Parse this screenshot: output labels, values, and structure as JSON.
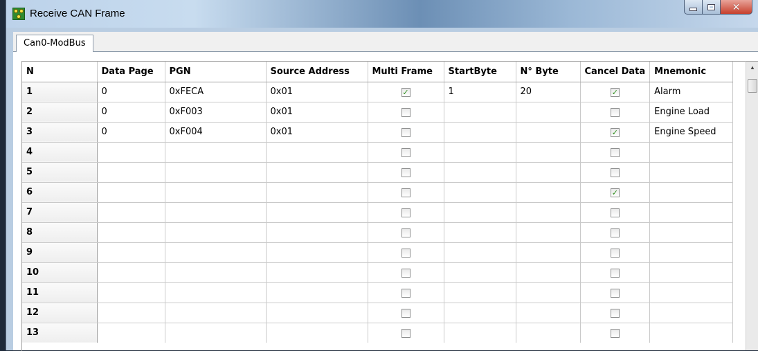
{
  "window": {
    "title": "Receive CAN Frame",
    "icon": "can-network-icon",
    "buttons": {
      "minimize": "minimize",
      "maximize": "maximize",
      "close": "close"
    }
  },
  "tabs": [
    {
      "label": "Can0-ModBus",
      "active": true
    }
  ],
  "table": {
    "columns": [
      "N",
      "Data Page",
      "PGN",
      "Source Address",
      "Multi Frame",
      "StartByte",
      "N° Byte",
      "Cancel Data",
      "Mnemonic"
    ],
    "rows": [
      {
        "n": "1",
        "data_page": "0",
        "pgn": "0xFECA",
        "source_address": "0x01",
        "multi_frame": true,
        "start_byte": "1",
        "n_byte": "20",
        "cancel_data": true,
        "mnemonic": "Alarm"
      },
      {
        "n": "2",
        "data_page": "0",
        "pgn": "0xF003",
        "source_address": "0x01",
        "multi_frame": false,
        "start_byte": "",
        "n_byte": "",
        "cancel_data": false,
        "mnemonic": "Engine Load"
      },
      {
        "n": "3",
        "data_page": "0",
        "pgn": "0xF004",
        "source_address": "0x01",
        "multi_frame": false,
        "start_byte": "",
        "n_byte": "",
        "cancel_data": true,
        "mnemonic": "Engine Speed"
      },
      {
        "n": "4",
        "data_page": "",
        "pgn": "",
        "source_address": "",
        "multi_frame": false,
        "start_byte": "",
        "n_byte": "",
        "cancel_data": false,
        "mnemonic": ""
      },
      {
        "n": "5",
        "data_page": "",
        "pgn": "",
        "source_address": "",
        "multi_frame": false,
        "start_byte": "",
        "n_byte": "",
        "cancel_data": false,
        "mnemonic": ""
      },
      {
        "n": "6",
        "data_page": "",
        "pgn": "",
        "source_address": "",
        "multi_frame": false,
        "start_byte": "",
        "n_byte": "",
        "cancel_data": true,
        "mnemonic": ""
      },
      {
        "n": "7",
        "data_page": "",
        "pgn": "",
        "source_address": "",
        "multi_frame": false,
        "start_byte": "",
        "n_byte": "",
        "cancel_data": false,
        "mnemonic": ""
      },
      {
        "n": "8",
        "data_page": "",
        "pgn": "",
        "source_address": "",
        "multi_frame": false,
        "start_byte": "",
        "n_byte": "",
        "cancel_data": false,
        "mnemonic": ""
      },
      {
        "n": "9",
        "data_page": "",
        "pgn": "",
        "source_address": "",
        "multi_frame": false,
        "start_byte": "",
        "n_byte": "",
        "cancel_data": false,
        "mnemonic": ""
      },
      {
        "n": "10",
        "data_page": "",
        "pgn": "",
        "source_address": "",
        "multi_frame": false,
        "start_byte": "",
        "n_byte": "",
        "cancel_data": false,
        "mnemonic": ""
      },
      {
        "n": "11",
        "data_page": "",
        "pgn": "",
        "source_address": "",
        "multi_frame": false,
        "start_byte": "",
        "n_byte": "",
        "cancel_data": false,
        "mnemonic": ""
      },
      {
        "n": "12",
        "data_page": "",
        "pgn": "",
        "source_address": "",
        "multi_frame": false,
        "start_byte": "",
        "n_byte": "",
        "cancel_data": false,
        "mnemonic": ""
      },
      {
        "n": "13",
        "data_page": "",
        "pgn": "",
        "source_address": "",
        "multi_frame": false,
        "start_byte": "",
        "n_byte": "",
        "cancel_data": false,
        "mnemonic": ""
      }
    ]
  },
  "colors": {
    "check_mark": "#2c8e1a",
    "grid_line": "#c9c9c9",
    "title_bar": "#bcd2ea",
    "close_button": "#c7402c"
  }
}
